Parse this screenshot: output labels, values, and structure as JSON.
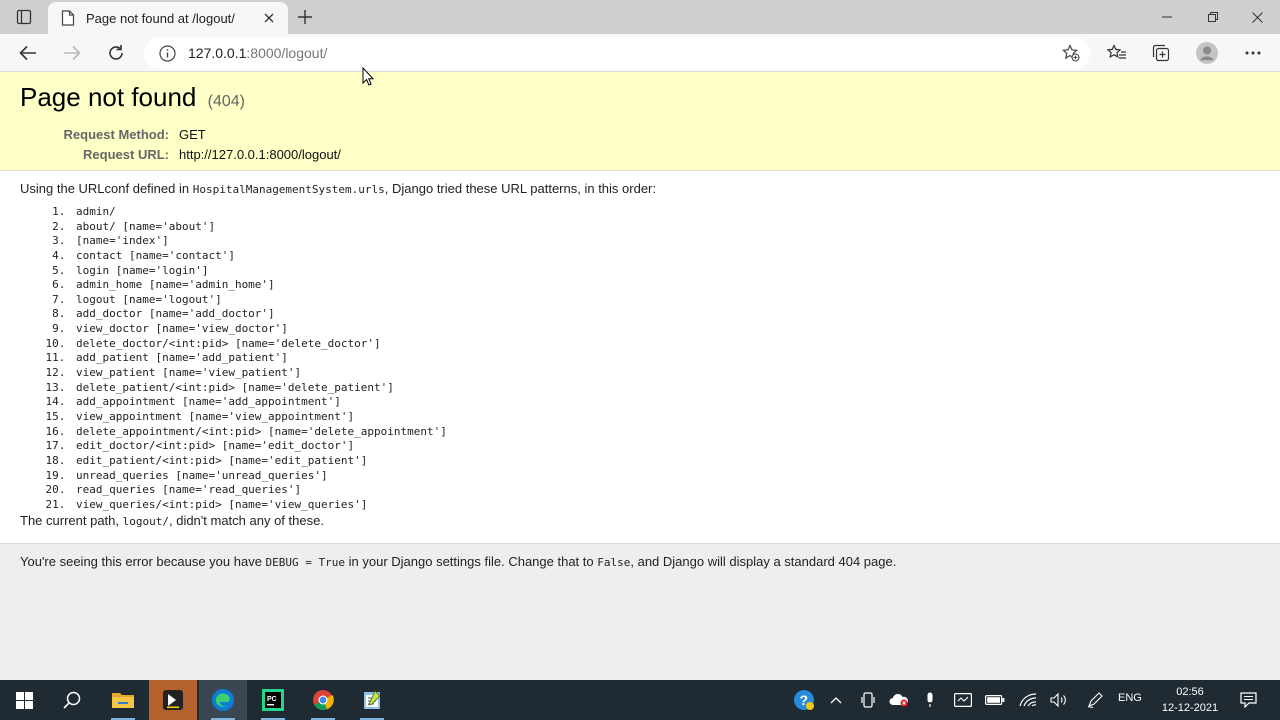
{
  "browser": {
    "tab_title": "Page not found at /logout/",
    "url_host": "127.0.0.1",
    "url_rest": ":8000/logout/"
  },
  "error": {
    "title": "Page not found",
    "status": "(404)",
    "request_method_label": "Request Method:",
    "request_method": "GET",
    "request_url_label": "Request URL:",
    "request_url": "http://127.0.0.1:8000/logout/"
  },
  "info": {
    "intro_before": "Using the URLconf defined in ",
    "urlconf": "HospitalManagementSystem.urls",
    "intro_after": ", Django tried these URL patterns, in this order:",
    "patterns": [
      "admin/",
      "about/ [name='about']",
      "[name='index']",
      "contact [name='contact']",
      "login [name='login']",
      "admin_home [name='admin_home']",
      "logout [name='logout']",
      "add_doctor [name='add_doctor']",
      "view_doctor [name='view_doctor']",
      "delete_doctor/<int:pid> [name='delete_doctor']",
      "add_patient [name='add_patient']",
      "view_patient [name='view_patient']",
      "delete_patient/<int:pid> [name='delete_patient']",
      "add_appointment [name='add_appointment']",
      "view_appointment [name='view_appointment']",
      "delete_appointment/<int:pid> [name='delete_appointment']",
      "edit_doctor/<int:pid> [name='edit_doctor']",
      "edit_patient/<int:pid> [name='edit_patient']",
      "unread_queries [name='unread_queries']",
      "read_queries [name='read_queries']",
      "view_queries/<int:pid> [name='view_queries']"
    ],
    "current_before": "The current path, ",
    "current_path": "logout/",
    "current_after": ", didn't match any of these."
  },
  "explanation": {
    "part1": "You're seeing this error because you have ",
    "debug_code": "DEBUG = True",
    "part2": " in your Django settings file. Change that to ",
    "false_code": "False",
    "part3": ", and Django will display a standard 404 page."
  },
  "taskbar": {
    "language": "ENG",
    "time": "02:56",
    "date": "12-12-2021"
  },
  "colors": {
    "summary_bg": "#ffffc8",
    "explanation_bg": "#eeeeee",
    "taskbar_bg": "#1f2a33"
  }
}
